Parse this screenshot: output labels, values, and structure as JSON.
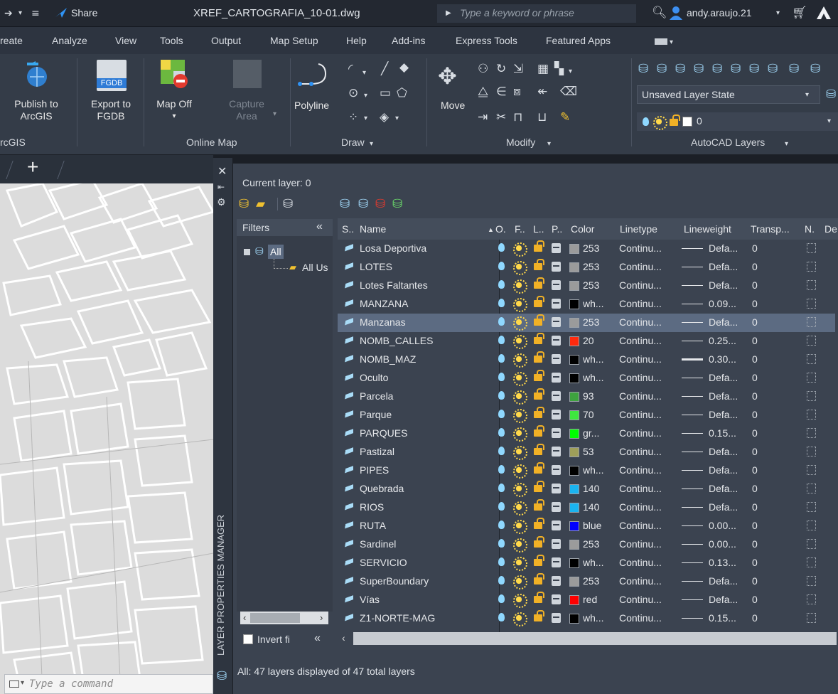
{
  "titlebar": {
    "share_label": "Share",
    "filename": "XREF_CARTOGRAFIA_10-01.dwg",
    "search_placeholder": "Type a keyword or phrase",
    "user": "andy.araujo.21"
  },
  "ribbon_tabs": [
    "reate",
    "Analyze",
    "View",
    "Tools",
    "Output",
    "Map Setup",
    "Help",
    "Add-ins",
    "Express Tools",
    "Featured Apps"
  ],
  "ribbon": {
    "publish_label_1": "Publish to",
    "publish_label_2": "ArcGIS",
    "fgdb_badge": "FGDB",
    "export_label_1": "Export to",
    "export_label_2": "FGDB",
    "mapoff_label": "Map Off",
    "capture_label_1": "Capture",
    "capture_label_2": "Area",
    "polyline_label": "Polyline",
    "move_label": "Move",
    "layer_state": "Unsaved Layer State",
    "current_layer_value": "0",
    "group_arcgis": "rcGIS",
    "group_online_map": "Online Map",
    "group_draw": "Draw",
    "group_modify": "Modify",
    "group_layers": "AutoCAD Layers"
  },
  "doc_tabs": {
    "add": "+"
  },
  "command_line": {
    "placeholder": "Type a command"
  },
  "palette": {
    "vertical_title": "LAYER PROPERTIES MANAGER",
    "current_layer": "Current layer: 0",
    "filters_header": "Filters",
    "collapse": "«",
    "tree_all": "All",
    "tree_all_used": "All Us",
    "invert_filter": "Invert fi",
    "status": "All: 47 layers displayed of 47 total layers",
    "columns": [
      "S..",
      "Name",
      "O.",
      "F..",
      "L..",
      "P..",
      "Color",
      "Linetype",
      "Lineweight",
      "Transp...",
      "N.",
      "De"
    ]
  },
  "layers": [
    {
      "name": "Losa Deportiva",
      "color_hex": "#9b9b9b",
      "color": "253",
      "linetype": "Continu...",
      "lineweight": "Defa...",
      "transp": "0",
      "thick": false,
      "selected": false
    },
    {
      "name": "LOTES",
      "color_hex": "#9b9b9b",
      "color": "253",
      "linetype": "Continu...",
      "lineweight": "Defa...",
      "transp": "0",
      "thick": false,
      "selected": false
    },
    {
      "name": "Lotes Faltantes",
      "color_hex": "#9b9b9b",
      "color": "253",
      "linetype": "Continu...",
      "lineweight": "Defa...",
      "transp": "0",
      "thick": false,
      "selected": false
    },
    {
      "name": "MANZANA",
      "color_hex": "#000000",
      "color": "wh...",
      "linetype": "Continu...",
      "lineweight": "0.09...",
      "transp": "0",
      "thick": false,
      "selected": false
    },
    {
      "name": "Manzanas",
      "color_hex": "#9b9b9b",
      "color": "253",
      "linetype": "Continu...",
      "lineweight": "Defa...",
      "transp": "0",
      "thick": false,
      "selected": true
    },
    {
      "name": "NOMB_CALLES",
      "color_hex": "#ff2a0e",
      "color": "20",
      "linetype": "Continu...",
      "lineweight": "0.25...",
      "transp": "0",
      "thick": false,
      "selected": false
    },
    {
      "name": "NOMB_MAZ",
      "color_hex": "#000000",
      "color": "wh...",
      "linetype": "Continu...",
      "lineweight": "0.30...",
      "transp": "0",
      "thick": true,
      "selected": false
    },
    {
      "name": "Oculto",
      "color_hex": "#000000",
      "color": "wh...",
      "linetype": "Continu...",
      "lineweight": "Defa...",
      "transp": "0",
      "thick": false,
      "selected": false
    },
    {
      "name": "Parcela",
      "color_hex": "#3ea33e",
      "color": "93",
      "linetype": "Continu...",
      "lineweight": "Defa...",
      "transp": "0",
      "thick": false,
      "selected": false
    },
    {
      "name": "Parque",
      "color_hex": "#3ee83e",
      "color": "70",
      "linetype": "Continu...",
      "lineweight": "Defa...",
      "transp": "0",
      "thick": false,
      "selected": false
    },
    {
      "name": "PARQUES",
      "color_hex": "#00ff00",
      "color": "gr...",
      "linetype": "Continu...",
      "lineweight": "0.15...",
      "transp": "0",
      "thick": false,
      "selected": false
    },
    {
      "name": "Pastizal",
      "color_hex": "#9f9f5a",
      "color": "53",
      "linetype": "Continu...",
      "lineweight": "Defa...",
      "transp": "0",
      "thick": false,
      "selected": false
    },
    {
      "name": "PIPES",
      "color_hex": "#000000",
      "color": "wh...",
      "linetype": "Continu...",
      "lineweight": "Defa...",
      "transp": "0",
      "thick": false,
      "selected": false
    },
    {
      "name": "Quebrada",
      "color_hex": "#1ab4f0",
      "color": "140",
      "linetype": "Continu...",
      "lineweight": "Defa...",
      "transp": "0",
      "thick": false,
      "selected": false
    },
    {
      "name": "RIOS",
      "color_hex": "#1ab4f0",
      "color": "140",
      "linetype": "Continu...",
      "lineweight": "Defa...",
      "transp": "0",
      "thick": false,
      "selected": false
    },
    {
      "name": "RUTA",
      "color_hex": "#0000ff",
      "color": "blue",
      "linetype": "Continu...",
      "lineweight": "0.00...",
      "transp": "0",
      "thick": false,
      "selected": false
    },
    {
      "name": "Sardinel",
      "color_hex": "#9b9b9b",
      "color": "253",
      "linetype": "Continu...",
      "lineweight": "0.00...",
      "transp": "0",
      "thick": false,
      "selected": false
    },
    {
      "name": "SERVICIO",
      "color_hex": "#000000",
      "color": "wh...",
      "linetype": "Continu...",
      "lineweight": "0.13...",
      "transp": "0",
      "thick": false,
      "selected": false
    },
    {
      "name": "SuperBoundary",
      "color_hex": "#9b9b9b",
      "color": "253",
      "linetype": "Continu...",
      "lineweight": "Defa...",
      "transp": "0",
      "thick": false,
      "selected": false
    },
    {
      "name": "Vías",
      "color_hex": "#ff0000",
      "color": "red",
      "linetype": "Continu...",
      "lineweight": "Defa...",
      "transp": "0",
      "thick": false,
      "selected": false
    },
    {
      "name": "Z1-NORTE-MAG",
      "color_hex": "#000000",
      "color": "wh...",
      "linetype": "Continu...",
      "lineweight": "0.15...",
      "transp": "0",
      "thick": false,
      "selected": false
    }
  ]
}
